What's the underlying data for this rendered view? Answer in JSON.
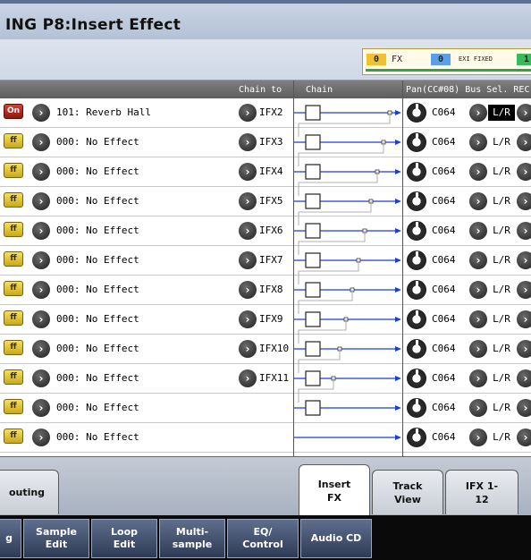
{
  "title": "ING P8:Insert Effect",
  "meters": [
    {
      "num": "0",
      "label": "FX",
      "color": "#f2c12e"
    },
    {
      "num": "0",
      "label": "EXI FIXED",
      "color": "#5aa0e6"
    },
    {
      "num": "1",
      "label": "",
      "color": "#3cb85c"
    }
  ],
  "header": {
    "chain_to": "Chain to",
    "chain": "Chain",
    "pan_bus": "Pan(CC#08) Bus Sel. REC"
  },
  "rows": [
    {
      "switch": "On",
      "effect": "101: Reverb Hall",
      "chain_to": "IFX2",
      "pan": "C064",
      "bus": "L/R",
      "bus_selected": true
    },
    {
      "switch": "ff",
      "effect": "000: No Effect",
      "chain_to": "IFX3",
      "pan": "C064",
      "bus": "L/R"
    },
    {
      "switch": "ff",
      "effect": "000: No Effect",
      "chain_to": "IFX4",
      "pan": "C064",
      "bus": "L/R"
    },
    {
      "switch": "ff",
      "effect": "000: No Effect",
      "chain_to": "IFX5",
      "pan": "C064",
      "bus": "L/R"
    },
    {
      "switch": "ff",
      "effect": "000: No Effect",
      "chain_to": "IFX6",
      "pan": "C064",
      "bus": "L/R"
    },
    {
      "switch": "ff",
      "effect": "000: No Effect",
      "chain_to": "IFX7",
      "pan": "C064",
      "bus": "L/R"
    },
    {
      "switch": "ff",
      "effect": "000: No Effect",
      "chain_to": "IFX8",
      "pan": "C064",
      "bus": "L/R"
    },
    {
      "switch": "ff",
      "effect": "000: No Effect",
      "chain_to": "IFX9",
      "pan": "C064",
      "bus": "L/R"
    },
    {
      "switch": "ff",
      "effect": "000: No Effect",
      "chain_to": "IFX10",
      "pan": "C064",
      "bus": "L/R"
    },
    {
      "switch": "ff",
      "effect": "000: No Effect",
      "chain_to": "IFX11",
      "pan": "C064",
      "bus": "L/R"
    },
    {
      "switch": "ff",
      "effect": "000: No Effect",
      "chain_to": "",
      "pan": "C064",
      "bus": "L/R"
    },
    {
      "switch": "ff",
      "effect": "000: No Effect",
      "chain_to": "",
      "pan": "C064",
      "bus": "L/R"
    }
  ],
  "tabs": [
    {
      "label": "outing"
    },
    {
      "label": "Insert FX",
      "active": true
    },
    {
      "label": "Track View"
    },
    {
      "label": "IFX 1-12"
    }
  ],
  "pages": [
    {
      "label": "g"
    },
    {
      "label": "Sample Edit"
    },
    {
      "label": "Loop Edit"
    },
    {
      "label": "Multi-sample"
    },
    {
      "label": "EQ/ Control"
    },
    {
      "label": "Audio CD"
    }
  ],
  "colors": {
    "accent": "#1a3fd6",
    "switch_on": "#c0352a",
    "switch_off": "#e5c93a"
  }
}
